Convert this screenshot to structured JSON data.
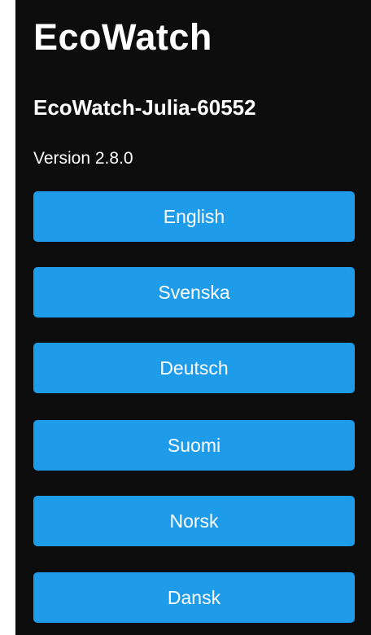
{
  "app": {
    "title": "EcoWatch",
    "device_name": "EcoWatch-Julia-60552",
    "version": "Version 2.8.0"
  },
  "languages": [
    {
      "label": "English"
    },
    {
      "label": "Svenska"
    },
    {
      "label": "Deutsch"
    },
    {
      "label": "Suomi"
    },
    {
      "label": "Norsk"
    },
    {
      "label": "Dansk"
    }
  ],
  "colors": {
    "background": "#0d0d0d",
    "button": "#1e9be9",
    "text": "#ffffff"
  }
}
